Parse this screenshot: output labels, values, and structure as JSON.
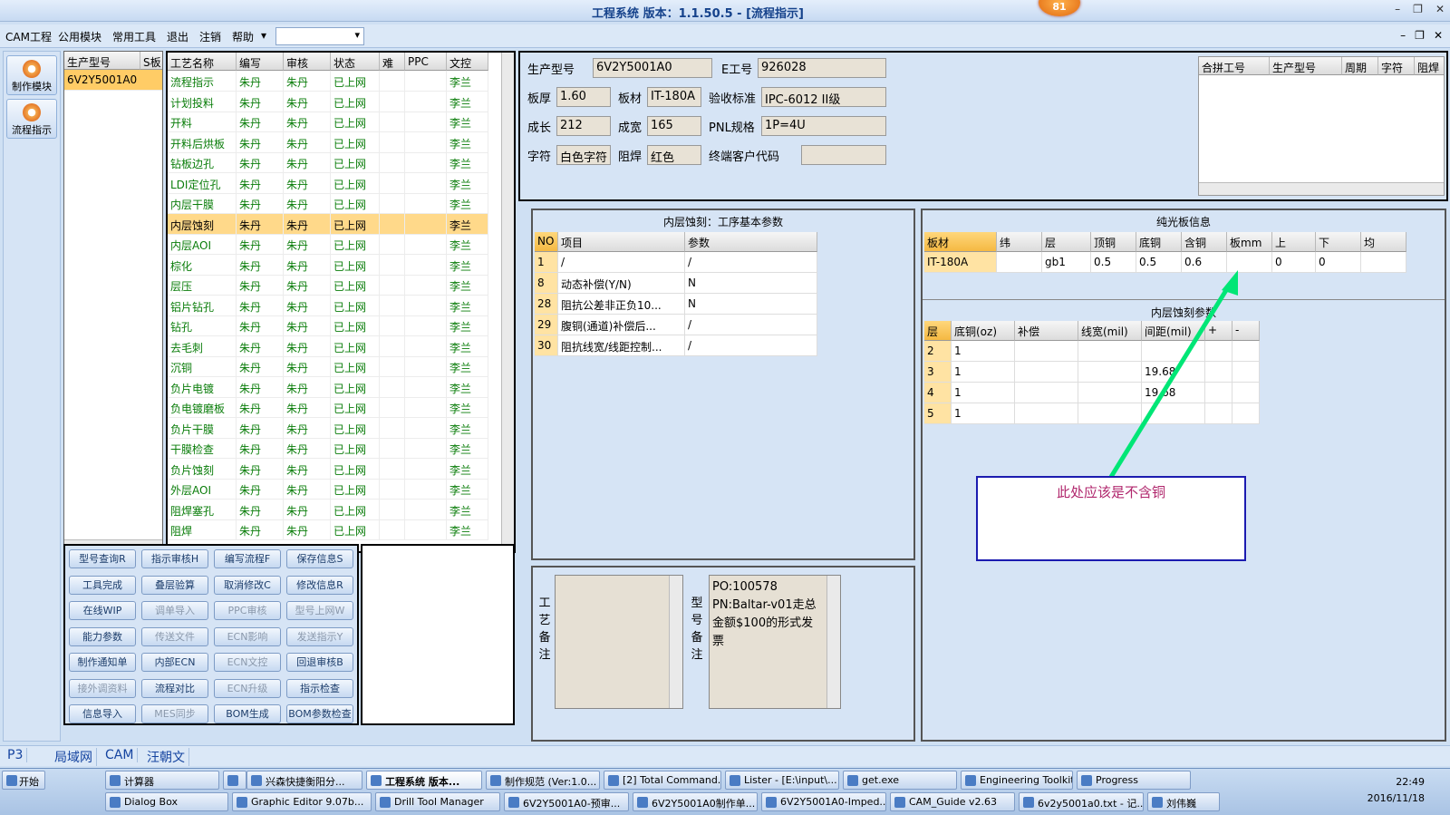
{
  "window": {
    "title": "工程系统   版本：1.1.50.5 - [流程指示]",
    "notif_count": "81"
  },
  "menu": {
    "items": [
      "CAM工程",
      "公用模块",
      "常用工具",
      "退出",
      "注销",
      "帮助"
    ],
    "help_arrow": "▾",
    "combo_value": ""
  },
  "nav": {
    "items": [
      "制作模块",
      "流程指示"
    ]
  },
  "models": {
    "headers": [
      "生产型号",
      "S板"
    ],
    "rows": [
      [
        "6V2Y5001A0",
        ""
      ]
    ]
  },
  "process": {
    "headers": [
      "工艺名称",
      "编写",
      "审核",
      "状态",
      "难",
      "PPC",
      "文控"
    ],
    "rows": [
      [
        "流程指示",
        "朱丹",
        "朱丹",
        "已上网",
        "",
        "",
        "李兰"
      ],
      [
        "计划投料",
        "朱丹",
        "朱丹",
        "已上网",
        "",
        "",
        "李兰"
      ],
      [
        "开料",
        "朱丹",
        "朱丹",
        "已上网",
        "",
        "",
        "李兰"
      ],
      [
        "开料后烘板",
        "朱丹",
        "朱丹",
        "已上网",
        "",
        "",
        "李兰"
      ],
      [
        "钻板边孔",
        "朱丹",
        "朱丹",
        "已上网",
        "",
        "",
        "李兰"
      ],
      [
        "LDI定位孔",
        "朱丹",
        "朱丹",
        "已上网",
        "",
        "",
        "李兰"
      ],
      [
        "内层干膜",
        "朱丹",
        "朱丹",
        "已上网",
        "",
        "",
        "李兰"
      ],
      [
        "内层蚀刻",
        "朱丹",
        "朱丹",
        "已上网",
        "",
        "",
        "李兰"
      ],
      [
        "内层AOI",
        "朱丹",
        "朱丹",
        "已上网",
        "",
        "",
        "李兰"
      ],
      [
        "棕化",
        "朱丹",
        "朱丹",
        "已上网",
        "",
        "",
        "李兰"
      ],
      [
        "层压",
        "朱丹",
        "朱丹",
        "已上网",
        "",
        "",
        "李兰"
      ],
      [
        "铝片钻孔",
        "朱丹",
        "朱丹",
        "已上网",
        "",
        "",
        "李兰"
      ],
      [
        "钻孔",
        "朱丹",
        "朱丹",
        "已上网",
        "",
        "",
        "李兰"
      ],
      [
        "去毛刺",
        "朱丹",
        "朱丹",
        "已上网",
        "",
        "",
        "李兰"
      ],
      [
        "沉铜",
        "朱丹",
        "朱丹",
        "已上网",
        "",
        "",
        "李兰"
      ],
      [
        "负片电镀",
        "朱丹",
        "朱丹",
        "已上网",
        "",
        "",
        "李兰"
      ],
      [
        "负电镀磨板",
        "朱丹",
        "朱丹",
        "已上网",
        "",
        "",
        "李兰"
      ],
      [
        "负片干膜",
        "朱丹",
        "朱丹",
        "已上网",
        "",
        "",
        "李兰"
      ],
      [
        "干膜检查",
        "朱丹",
        "朱丹",
        "已上网",
        "",
        "",
        "李兰"
      ],
      [
        "负片蚀刻",
        "朱丹",
        "朱丹",
        "已上网",
        "",
        "",
        "李兰"
      ],
      [
        "外层AOI",
        "朱丹",
        "朱丹",
        "已上网",
        "",
        "",
        "李兰"
      ],
      [
        "阻焊塞孔",
        "朱丹",
        "朱丹",
        "已上网",
        "",
        "",
        "李兰"
      ],
      [
        "阻焊",
        "朱丹",
        "朱丹",
        "已上网",
        "",
        "",
        "李兰"
      ]
    ],
    "selected_index": 7
  },
  "buttons": [
    [
      "型号查询R",
      "指示审核H",
      "编写流程F",
      "保存信息S"
    ],
    [
      "工具完成",
      "叠层验算",
      "取消修改C",
      "修改信息R"
    ],
    [
      "在线WIP",
      "调单导入",
      "PPC审核",
      "型号上网W"
    ],
    [
      "能力参数",
      "传送文件",
      "ECN影响",
      "发送指示Y"
    ],
    [
      "制作通知单",
      "内部ECN",
      "ECN文控",
      "回退审核B"
    ],
    [
      "接外调资料",
      "流程对比",
      "ECN升级",
      "指示检查"
    ],
    [
      "信息导入",
      "MES同步",
      "BOM生成",
      "BOM参数检查"
    ]
  ],
  "disabled_buttons": [
    "调单导入",
    "PPC审核",
    "型号上网W",
    "传送文件",
    "ECN影响",
    "发送指示Y",
    "ECN文控",
    "接外调资料",
    "ECN升级",
    "MES同步"
  ],
  "info": {
    "lbl_model": "生产型号",
    "model": "6V2Y5001A0",
    "lbl_eno": "E工号",
    "eno": "926028",
    "lbl_thick": "板厚",
    "thick": "1.60",
    "lbl_material": "板材",
    "material": "IT-180A",
    "lbl_standard": "验收标准",
    "standard": "IPC-6012 II级",
    "lbl_len": "成长",
    "len": "212",
    "lbl_wid": "成宽",
    "wid": "165",
    "lbl_pnl": "PNL规格",
    "pnl": "1P=4U",
    "lbl_char": "字符",
    "char": "白色字符",
    "lbl_mask": "阻焊",
    "mask": "红色",
    "lbl_customer": "终端客户代码",
    "customer": ""
  },
  "merge": {
    "headers": [
      "合拼工号",
      "生产型号",
      "周期",
      "字符",
      "阻焊"
    ]
  },
  "params": {
    "title": "内层蚀刻：工序基本参数",
    "headers": [
      "NO",
      "项目",
      "参数"
    ],
    "rows": [
      [
        "1",
        "/",
        "/"
      ],
      [
        "8",
        "动态补偿(Y/N)",
        "N"
      ],
      [
        "28",
        "阻抗公差非正负10...",
        "N"
      ],
      [
        "29",
        "腹铜(通道)补偿后...",
        "/"
      ],
      [
        "30",
        "阻抗线宽/线距控制...",
        "/"
      ]
    ]
  },
  "core": {
    "title": "纯光板信息",
    "headers": [
      "板材",
      "纬",
      "层",
      "顶铜",
      "底铜",
      "含铜",
      "板mm",
      "上",
      "下",
      "均"
    ],
    "rows": [
      [
        "IT-180A",
        "",
        "gb1",
        "0.5",
        "0.5",
        "0.6",
        "",
        "0",
        "0",
        ""
      ]
    ]
  },
  "etch": {
    "title": "内层蚀刻参数",
    "headers": [
      "层",
      "底铜(oz)",
      "补偿",
      "线宽(mil)",
      "间距(mil)",
      "+",
      "-"
    ],
    "rows": [
      [
        "2",
        "1",
        "",
        "",
        "",
        "",
        ""
      ],
      [
        "3",
        "1",
        "",
        "",
        "19.68",
        "",
        ""
      ],
      [
        "4",
        "1",
        "",
        "",
        "19.68",
        "",
        ""
      ],
      [
        "5",
        "1",
        "",
        "",
        "",
        "",
        ""
      ]
    ]
  },
  "remarks": {
    "process_label": "工艺备注",
    "process_text": "",
    "model_label": "型号备注",
    "model_text": "PO:100578\nPN:Baltar-v01走总金额$100的形式发票"
  },
  "annotation": {
    "text": "此处应该是不含铜",
    "arrow_color": "#00e676"
  },
  "status": {
    "page": "P3",
    "tabs": [
      "局域网",
      "CAM",
      "汪朝文"
    ]
  },
  "taskbar": {
    "start": "开始",
    "row1": [
      "计算器",
      "",
      "兴森快捷衡阳分...",
      "工程系统  版本...",
      "制作规范 (Ver:1.0...",
      "[2] Total Command...",
      "Lister - [E:\\input\\...",
      "get.exe",
      "Engineering Toolkit...",
      "Progress"
    ],
    "row2": [
      "Dialog Box",
      "Graphic Editor 9.07b...",
      "Drill Tool Manager",
      "6V2Y5001A0-预审...",
      "6V2Y5001A0制作单...",
      "6V2Y5001A0-Imped...",
      "CAM_Guide v2.63",
      "6v2y5001a0.txt - 记...",
      "刘伟巍"
    ],
    "time": "22:49",
    "date": "2016/11/18"
  }
}
